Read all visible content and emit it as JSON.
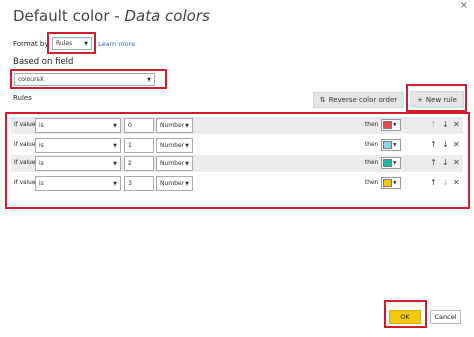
{
  "dialog": {
    "title_prefix": "Default color - ",
    "title_italic": "Data colors",
    "close_glyph": "×"
  },
  "format_by": {
    "label": "Format by",
    "value": "Rules",
    "learn_more": "Learn more"
  },
  "based_on": {
    "label": "Based on field",
    "value": "coloursX"
  },
  "rules": {
    "label": "Rules",
    "reverse_button": "Reverse color order",
    "new_rule_button": "New rule",
    "rows": [
      {
        "if_label": "If value",
        "operator": "is",
        "value": "0",
        "type": "Number",
        "then_label": "then",
        "color": "#e84a4f",
        "up_enabled": false,
        "down_enabled": true
      },
      {
        "if_label": "If value",
        "operator": "is",
        "value": "1",
        "type": "Number",
        "then_label": "then",
        "color": "#8fd3e8",
        "up_enabled": true,
        "down_enabled": true
      },
      {
        "if_label": "If value",
        "operator": "is",
        "value": "2",
        "type": "Number",
        "then_label": "then",
        "color": "#1fb7a6",
        "up_enabled": true,
        "down_enabled": true
      },
      {
        "if_label": "If value",
        "operator": "is",
        "value": "3",
        "type": "Number",
        "then_label": "then",
        "color": "#f2c811",
        "up_enabled": true,
        "down_enabled": false
      }
    ]
  },
  "footer": {
    "ok": "OK",
    "cancel": "Cancel"
  },
  "colors": {
    "highlight_red": "#d21e2b",
    "ok_yellow": "#f2c811",
    "link_blue": "#2a6ac8"
  },
  "icons": {
    "close": "close-icon",
    "reverse": "reverse-order-icon",
    "add": "plus-icon",
    "up": "arrow-up-icon",
    "down": "arrow-down-icon",
    "delete": "delete-icon",
    "dropdown": "chevron-down-icon"
  }
}
